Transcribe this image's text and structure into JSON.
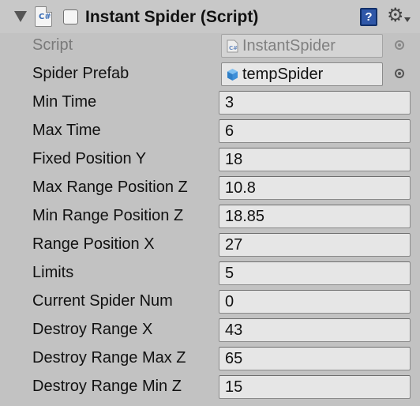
{
  "component": {
    "title": "Instant Spider (Script)",
    "enabled": false,
    "icons": {
      "foldout": "triangle-down-icon",
      "script": "cs-script-icon",
      "help": "help-book-icon",
      "settings": "gear-icon"
    },
    "script_icon_text": "C#",
    "help_icon_text": "?"
  },
  "script_row": {
    "label": "Script",
    "value": "InstantSpider"
  },
  "prefab_row": {
    "label": "Spider Prefab",
    "value": "tempSpider"
  },
  "fields": [
    {
      "label": "Min Time",
      "value": "3"
    },
    {
      "label": "Max Time",
      "value": "6"
    },
    {
      "label": "Fixed Position Y",
      "value": "18"
    },
    {
      "label": "Max Range Position Z",
      "value": "10.8"
    },
    {
      "label": "Min Range Position Z",
      "value": "18.85"
    },
    {
      "label": "Range Position X",
      "value": "27"
    },
    {
      "label": "Limits",
      "value": "5"
    },
    {
      "label": "Current Spider Num",
      "value": "0"
    },
    {
      "label": "Destroy Range X",
      "value": "43"
    },
    {
      "label": "Destroy Range Max Z",
      "value": "65"
    },
    {
      "label": "Destroy Range Min Z",
      "value": "15"
    }
  ],
  "colors": {
    "panel_bg": "#c2c2c2",
    "field_bg": "#e6e6e6",
    "help_blue": "#2f57a8",
    "prefab_cube": "#3d8fd9"
  }
}
